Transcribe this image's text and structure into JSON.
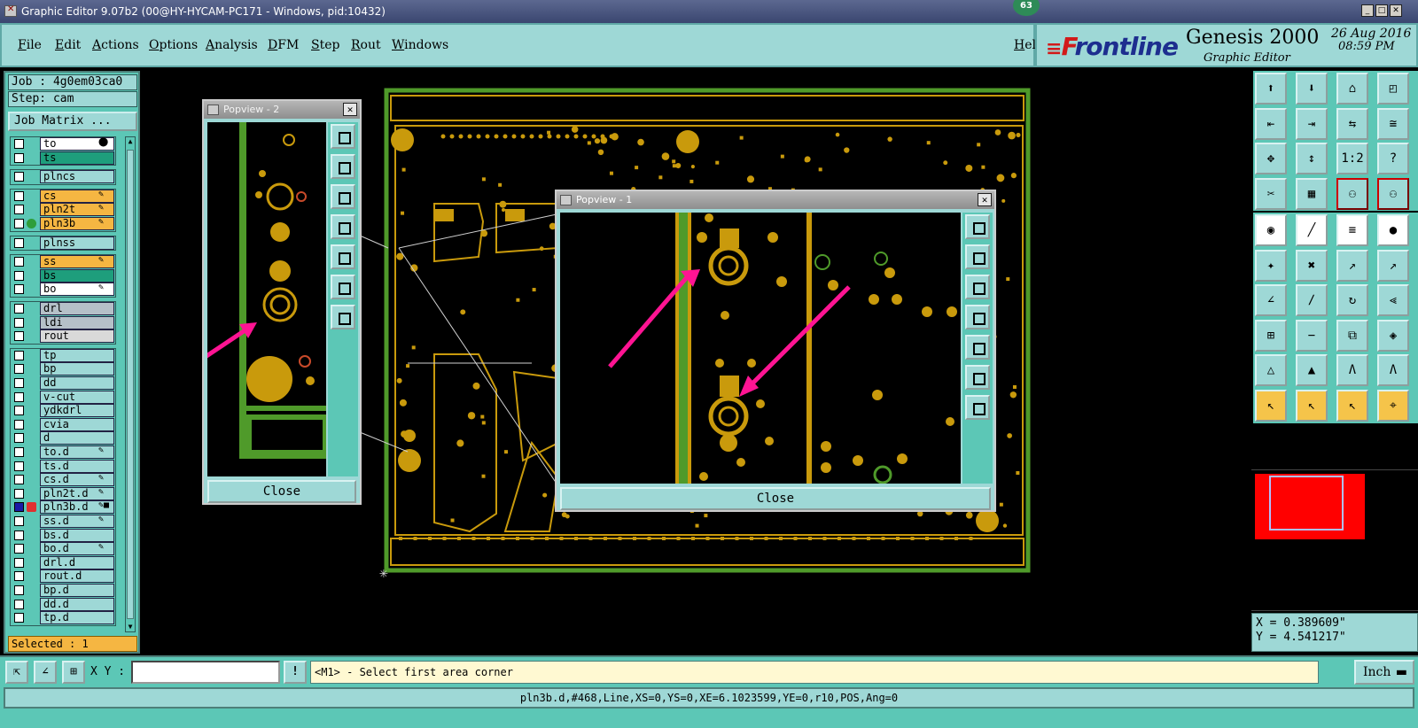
{
  "window": {
    "title": "Graphic Editor 9.07b2 (00@HY-HYCAM-PC171 - Windows, pid:10432)",
    "notification_count": "63",
    "controls": [
      "_",
      "□",
      "✕"
    ]
  },
  "menubar": {
    "items": [
      "File",
      "Edit",
      "Actions",
      "Options",
      "Analysis",
      "DFM",
      "Step",
      "Rout",
      "Windows"
    ],
    "help": "Help"
  },
  "brand": {
    "logo_prefix": "F",
    "logo_rest": "rontline",
    "product": "Genesis 2000",
    "subtitle": "Graphic Editor",
    "date": "26 Aug 2016",
    "time": "08:59 PM"
  },
  "left_panel": {
    "job": "Job : 4g0em03ca0",
    "step": "Step: cam",
    "job_matrix": "Job Matrix ...",
    "selected": "Selected : 1",
    "layers": [
      {
        "name": "to",
        "color": "#ffffff",
        "tag": "⬤"
      },
      {
        "name": "ts",
        "color": "#1e9e7c",
        "tag": ""
      },
      {
        "name": "plncs",
        "color": "#9ed8d6",
        "tag": ""
      },
      {
        "name": "cs",
        "color": "#f5b642",
        "tag": "✎"
      },
      {
        "name": "pln2t",
        "color": "#f5b642",
        "tag": "✎"
      },
      {
        "name": "pln3b",
        "color": "#f5b642",
        "tag": "✎",
        "dot": "#2e9e3a"
      },
      {
        "name": "plnss",
        "color": "#9ed8d6",
        "tag": ""
      },
      {
        "name": "ss",
        "color": "#f5b642",
        "tag": "✎"
      },
      {
        "name": "bs",
        "color": "#1e9e7c",
        "tag": ""
      },
      {
        "name": "bo",
        "color": "#ffffff",
        "tag": "✎"
      },
      {
        "name": "drl",
        "color": "#b5c0c8",
        "tag": ""
      },
      {
        "name": "ldi",
        "color": "#b5c0c8",
        "tag": ""
      },
      {
        "name": "rout",
        "color": "#d9d9d9",
        "tag": ""
      },
      {
        "name": "tp",
        "color": "#9ed8d6",
        "tag": ""
      },
      {
        "name": "bp",
        "color": "#9ed8d6",
        "tag": ""
      },
      {
        "name": "dd",
        "color": "#9ed8d6",
        "tag": ""
      },
      {
        "name": "v-cut",
        "color": "#9ed8d6",
        "tag": ""
      },
      {
        "name": "ydkdrl",
        "color": "#9ed8d6",
        "tag": ""
      },
      {
        "name": "cvia",
        "color": "#9ed8d6",
        "tag": ""
      },
      {
        "name": "d",
        "color": "#9ed8d6",
        "tag": ""
      },
      {
        "name": "to.d",
        "color": "#9ed8d6",
        "tag": "✎"
      },
      {
        "name": "ts.d",
        "color": "#9ed8d6",
        "tag": ""
      },
      {
        "name": "cs.d",
        "color": "#9ed8d6",
        "tag": "✎"
      },
      {
        "name": "pln2t.d",
        "color": "#9ed8d6",
        "tag": "✎"
      },
      {
        "name": "pln3b.d",
        "color": "#9ed8d6",
        "tag": "✎■",
        "active": true
      },
      {
        "name": "ss.d",
        "color": "#9ed8d6",
        "tag": "✎"
      },
      {
        "name": "bs.d",
        "color": "#9ed8d6",
        "tag": ""
      },
      {
        "name": "bo.d",
        "color": "#9ed8d6",
        "tag": "✎"
      },
      {
        "name": "drl.d",
        "color": "#9ed8d6",
        "tag": ""
      },
      {
        "name": "rout.d",
        "color": "#9ed8d6",
        "tag": ""
      },
      {
        "name": "bp.d",
        "color": "#9ed8d6",
        "tag": ""
      },
      {
        "name": "dd.d",
        "color": "#9ed8d6",
        "tag": ""
      },
      {
        "name": "tp.d",
        "color": "#9ed8d6",
        "tag": ""
      }
    ]
  },
  "popview2": {
    "title": "Popview - 2",
    "close": "Close"
  },
  "popview1": {
    "title": "Popview - 1",
    "close": "Close"
  },
  "toolbox": {
    "rows": [
      [
        "⬆",
        "⬇",
        "⌂",
        "◰"
      ],
      [
        "⇤",
        "⇥",
        "⇆",
        "≅"
      ],
      [
        "✥",
        "↕",
        "1:2",
        "?"
      ],
      [
        "✂",
        "▦",
        "⚇",
        "⚇"
      ],
      [
        "◉",
        "╱",
        "≡",
        "●"
      ],
      [
        "✦",
        "✖",
        "↗",
        "↗"
      ],
      [
        "∠",
        "∕",
        "↻",
        "⪡"
      ],
      [
        "⊞",
        "−",
        "⧉",
        "◈"
      ],
      [
        "△",
        "▲",
        "Ʌ",
        "Ʌ"
      ],
      [
        "↖",
        "↖",
        "↖",
        "⌖"
      ]
    ]
  },
  "coords": {
    "x": "X = 0.389609\"",
    "y": "Y = 4.541217\""
  },
  "command_bar": {
    "xy_label": "X Y :",
    "xy_value": "",
    "alert_icon": "!",
    "prompt": "<M1> - Select first area corner",
    "unit": "Inch"
  },
  "status": {
    "text": "pln3b.d,#468,Line,XS=0,YS=0,XE=6.1023599,YE=0,r10,POS,Ang=0"
  }
}
